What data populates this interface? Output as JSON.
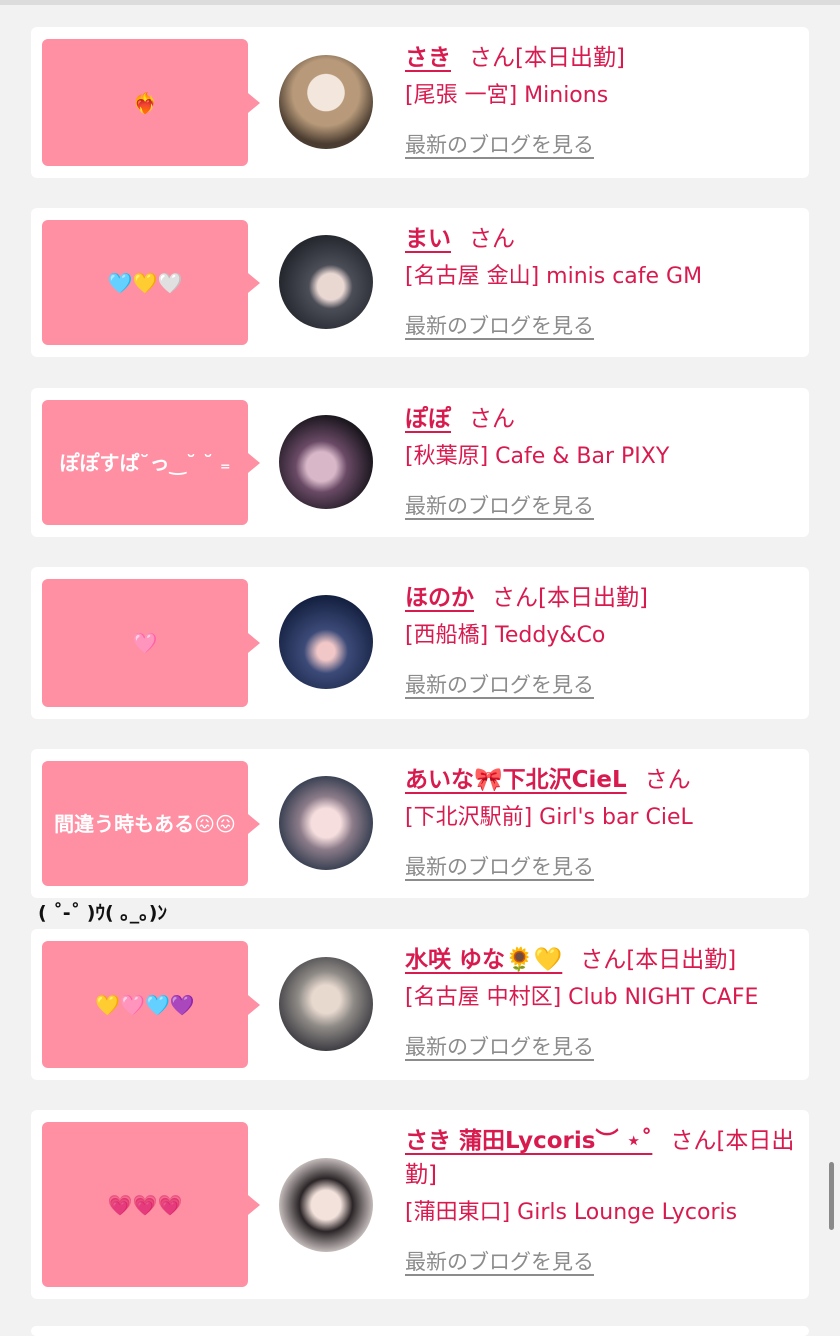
{
  "colors": {
    "accent": "#d81b4f",
    "bubble": "#ff8fa3",
    "link_gray": "#8c8c8c",
    "background": "#f2f2f2"
  },
  "common": {
    "san": "さん",
    "blog_link": "最新のブログを見る"
  },
  "cards": [
    {
      "message": "❤️‍🔥",
      "name": "さき",
      "badge": "[本日出勤]",
      "shop": "[尾張 一宮] Minions"
    },
    {
      "message": "🩵💛🤍",
      "name": "まい",
      "badge": "",
      "shop": "[名古屋 金山] minis cafe GM"
    },
    {
      "message": "ぽぽすぱ˘っ‿˘ ˘ ₌",
      "name": "ぽぽ",
      "badge": "",
      "shop": "[秋葉原] Cafe & Bar PIXY"
    },
    {
      "message": "🩷",
      "name": "ほのか",
      "badge": "[本日出勤]",
      "shop": "[西船橋] Teddy&Co"
    },
    {
      "message": "間違う時もある😖😖",
      "name": "あいな🎀下北沢CieL",
      "badge": "",
      "shop": "[下北沢駅前] Girl's bar CieL"
    },
    {
      "message": "💛🩷🩵💜",
      "name": "水咲 ゆな🌻💛",
      "badge": "[本日出勤]",
      "shop": "[名古屋 中村区] Club NIGHT CAFE"
    },
    {
      "message": "💗💗💗",
      "name": "さき 蒲田Lycoris︶ ⋆˚",
      "badge": "[本日出勤]",
      "shop": "[蒲田東口] Girls Lounge Lycoris"
    }
  ],
  "emoticon": "( ˚-˚ )ｳ( ｡_｡)ﾝ"
}
